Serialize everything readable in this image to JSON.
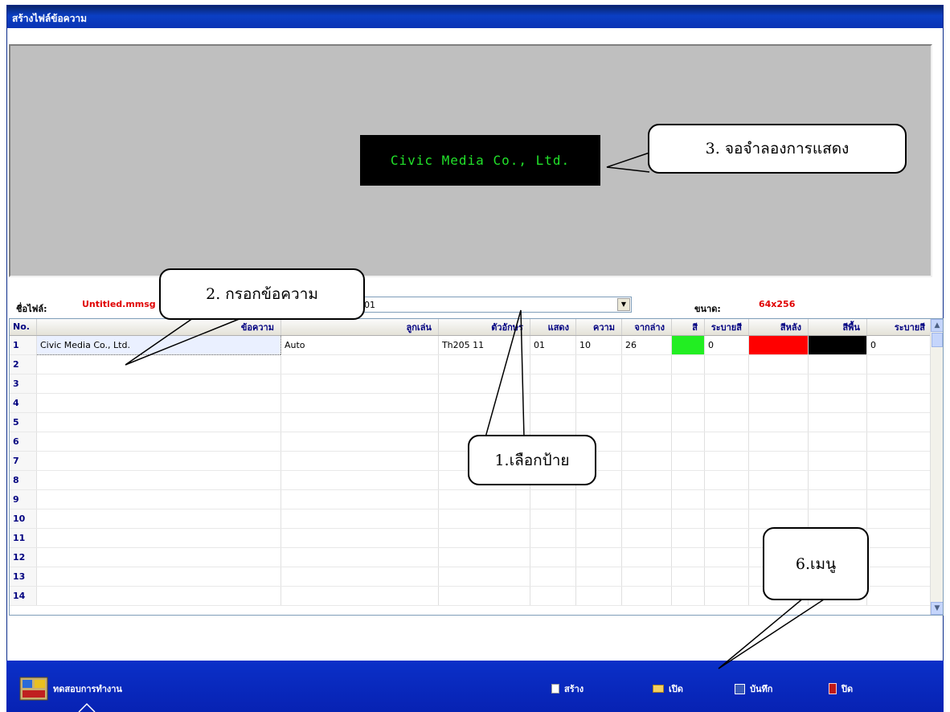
{
  "window": {
    "title": "สร้างไฟล์ข้อความ"
  },
  "preview": {
    "led_text": "Civic Media Co., Ltd."
  },
  "fileinfo": {
    "filename_label": "ชื่อไฟล์:",
    "filename_value": "Untitled.mmsg",
    "sign_value": "01",
    "size_label": "ขนาด:",
    "size_value": "64x256"
  },
  "grid": {
    "columns": [
      "No.",
      "ข้อความ",
      "ลูกเล่น",
      "ตัวอักษร",
      "แสดง",
      "ความ",
      "จากล่าง",
      "สี",
      "ระบายสี",
      "สีหลัง",
      "สีพื้น",
      "ระบายสี"
    ],
    "rows": [
      {
        "no": "1",
        "text": "Civic Media Co., Ltd.",
        "effect": "Auto",
        "font": "Th205 11",
        "show": "01",
        "speed": "10",
        "from_bottom": "26",
        "color": "#22ee22",
        "shade": "0",
        "back_color": "#ff0000",
        "floor_color": "#000000",
        "shade2": "0"
      },
      {
        "no": "2"
      },
      {
        "no": "3"
      },
      {
        "no": "4"
      },
      {
        "no": "5"
      },
      {
        "no": "6"
      },
      {
        "no": "7"
      },
      {
        "no": "8"
      },
      {
        "no": "9"
      },
      {
        "no": "10"
      },
      {
        "no": "11"
      },
      {
        "no": "12"
      },
      {
        "no": "13"
      },
      {
        "no": "14"
      }
    ]
  },
  "toolbar": {
    "test_label": "ทดสอบการทำงาน",
    "new_label": "สร้าง",
    "open_label": "เปิด",
    "save_label": "บันทึก",
    "close_label": "ปิด"
  },
  "callouts": {
    "select_sign": "1.เลือกป้าย",
    "enter_text": "2. กรอกข้อความ",
    "simulator": "3. จอจำลองการแสดง",
    "menu": "6.เมนู"
  },
  "colors": {
    "accent": "#0a34b5",
    "led_text": "#22e12a",
    "label_red": "#e00000",
    "header_text": "#000080"
  }
}
